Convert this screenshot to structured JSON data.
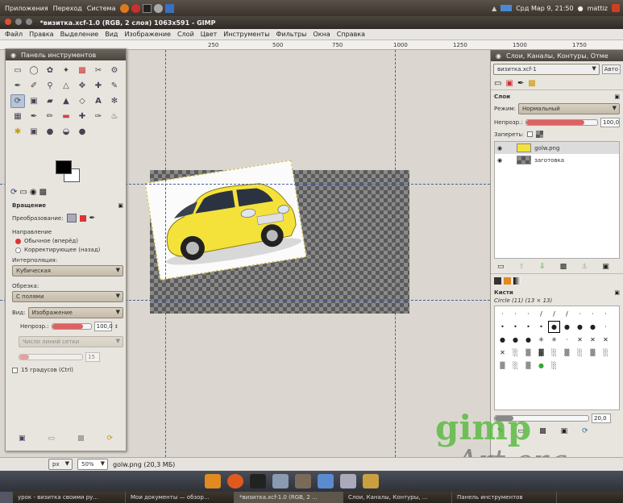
{
  "topbar": {
    "menus": [
      "Приложения",
      "Переход",
      "Система"
    ],
    "clock": "Срд Мар 9, 21:50",
    "user": "mattiz"
  },
  "window": {
    "title": "*визитка.xcf-1.0 (RGB, 2 слоя) 1063x591 - GIMP"
  },
  "menubar": [
    "Файл",
    "Правка",
    "Выделение",
    "Вид",
    "Изображение",
    "Слой",
    "Цвет",
    "Инструменты",
    "Фильтры",
    "Окна",
    "Справка"
  ],
  "ruler": [
    "250",
    "500",
    "750",
    "1000",
    "1250",
    "1500",
    "1750"
  ],
  "toolbox": {
    "title": "Панель инструментов",
    "options_title": "Вращение",
    "transform_label": "Преобразование:",
    "direction_label": "Направление",
    "direction_normal": "Обычное (вперёд)",
    "direction_corrective": "Корректирующее (назад)",
    "interpolation_label": "Интерполяция:",
    "interpolation_value": "Кубическая",
    "clipping_label": "Обрезка:",
    "clipping_value": "С полями",
    "view_label": "Вид:",
    "view_value": "Изображение",
    "opacity_label": "Непрозр.:",
    "opacity_value": "100,0",
    "grid_value": "Число линий сетки",
    "grid_num": "15",
    "degrees_label": "15 градусов (Ctrl)"
  },
  "rightpanel": {
    "title": "Слои, Каналы, Контуры, Отме",
    "image_select": "визитка.xcf-1",
    "auto_label": "Авто",
    "layers_title": "Слои",
    "mode_label": "Режим:",
    "mode_value": "Нормальный",
    "opacity_label": "Непрозр.:",
    "opacity_value": "100,0",
    "lock_label": "Запереть:",
    "layers": [
      {
        "name": "golw.png"
      },
      {
        "name": "заготовка"
      }
    ],
    "brushes_title": "Кисти",
    "brush_name": "Circle (11) (13 × 13)",
    "brush_spacing": "20,0"
  },
  "statusbar": {
    "unit": "px",
    "zoom": "50%",
    "info": "golw.png (20,3 МБ)"
  },
  "watermark": {
    "line1": "gimp",
    "line2": "Art.org"
  },
  "taskbar": [
    "урок - визитка своими ру...",
    "Мои документы — обзор...",
    "*визитка.xcf-1.0 (RGB, 2 ...",
    "Слои, Каналы, Контуры, ...",
    "Панель инструментов"
  ]
}
